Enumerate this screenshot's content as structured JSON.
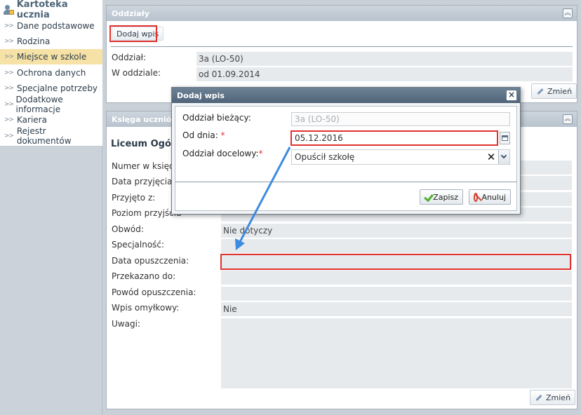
{
  "sidebar": {
    "title": "Kartoteka ucznia",
    "items": [
      {
        "label": "Dane podstawowe"
      },
      {
        "label": "Rodzina"
      },
      {
        "label": "Miejsce w szkole"
      },
      {
        "label": "Ochrona danych"
      },
      {
        "label": "Specjalne potrzeby"
      },
      {
        "label": "Dodatkowe informacje"
      },
      {
        "label": "Kariera"
      },
      {
        "label": "Rejestr dokumentów"
      }
    ],
    "chevron": ">>"
  },
  "oddzialy": {
    "title": "Oddziały",
    "add_button": "Dodaj wpis",
    "oddzial_label": "Oddział:",
    "oddzial_value": "3a (LO-50)",
    "w_oddziale_label": "W oddziale:",
    "w_oddziale_value": "od 01.09.2014",
    "edit_button": "Zmień"
  },
  "ksiega": {
    "title": "Księga uczniów",
    "subtitle": "Liceum Ogólno",
    "fields": [
      {
        "label": "Numer w księdz",
        "value": ""
      },
      {
        "label": "Data przyjęcia:",
        "value": ""
      },
      {
        "label": "Przyjęto z:",
        "value": ""
      },
      {
        "label": "Poziom przyjścia",
        "value": ""
      },
      {
        "label": "Obwód:",
        "value": "Nie dotyczy"
      },
      {
        "label": "Specjalność:",
        "value": ""
      },
      {
        "label": "Data opuszczenia:",
        "value": ""
      },
      {
        "label": "Przekazano do:",
        "value": ""
      },
      {
        "label": "Powód opuszczenia:",
        "value": ""
      },
      {
        "label": "Wpis omyłkowy:",
        "value": "Nie"
      },
      {
        "label": "Uwagi:",
        "value": ""
      }
    ],
    "edit_button": "Zmień"
  },
  "dialog": {
    "title": "Dodaj wpis",
    "close": "×",
    "current_label": "Oddział bieżący:",
    "current_value": "3a (LO-50)",
    "from_label": "Od dnia:",
    "from_value": "05.12.2016",
    "target_label": "Oddział docelowy:",
    "target_value": "Opuścił szkołę",
    "required_mark": "*",
    "save_button": "Zapisz",
    "cancel_button": "Anuluj"
  },
  "colors": {
    "highlight_red": "#e0322f",
    "arrow_blue": "#3d8be0",
    "active_item": "#f6e2a6"
  }
}
